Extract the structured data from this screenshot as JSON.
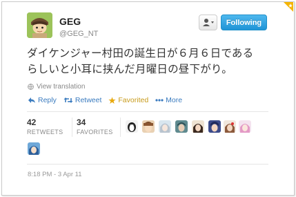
{
  "user": {
    "display_name": "GEG",
    "handle": "@GEG_NT",
    "avatar_icon": "cartoon-character-avatar"
  },
  "header": {
    "user_menu_icon": "person-dropdown-icon",
    "follow_label": "Following"
  },
  "tweet": {
    "line1": "ダイケンジャー村田の誕生日が６月６日である",
    "line2": "らしいと小耳に挟んだ月曜日の昼下がり。",
    "view_translation": "View translation"
  },
  "actions": {
    "reply": "Reply",
    "retweet": "Retweet",
    "favorited": "Favorited",
    "more": "More"
  },
  "stats": {
    "retweets_count": "42",
    "retweets_label": "RETWEETS",
    "favorites_count": "34",
    "favorites_label": "FAVORITES"
  },
  "timestamp": "8:18 PM - 3 Apr 11",
  "colors": {
    "link": "#3a7bbf",
    "favorited": "#c79a1a",
    "follow_button": "#2a9fdf"
  }
}
